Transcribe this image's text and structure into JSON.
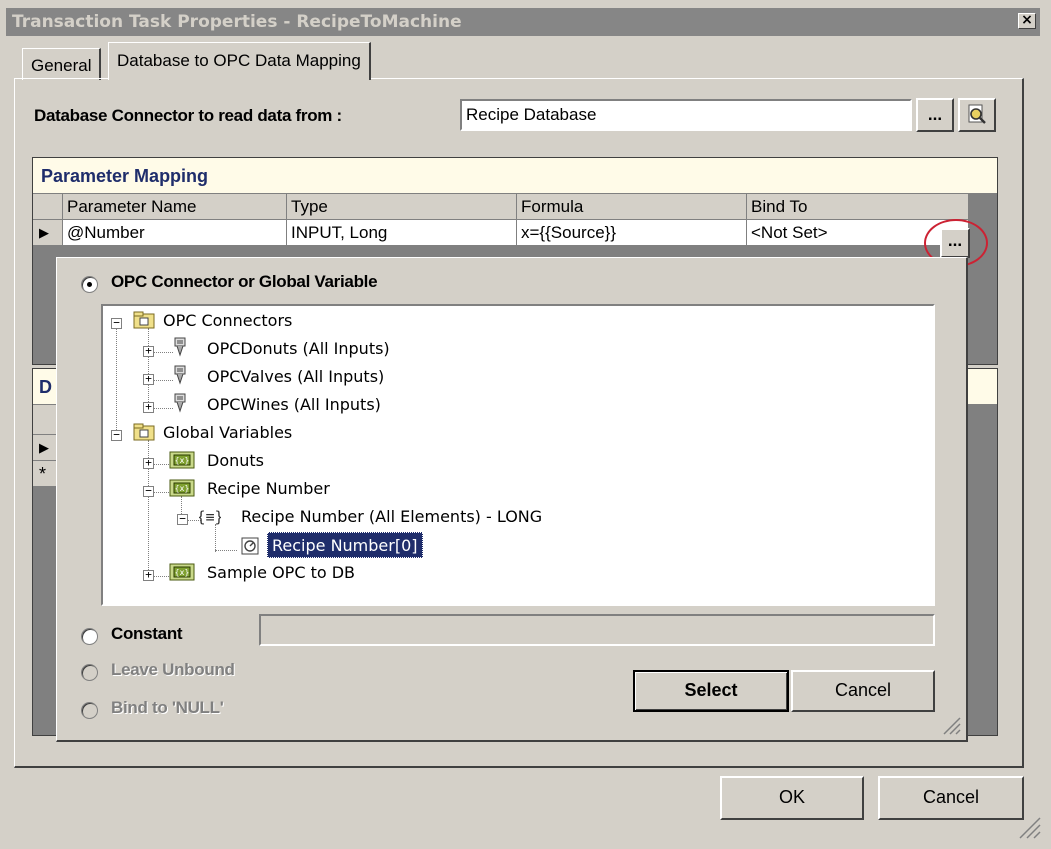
{
  "window": {
    "title": "Transaction Task Properties - RecipeToMachine",
    "close_glyph": "×"
  },
  "tabs": [
    {
      "label": "General"
    },
    {
      "label": "Database to OPC Data Mapping"
    }
  ],
  "db_connector": {
    "label": "Database Connector to read data from :",
    "value": "Recipe Database",
    "browse_label": "..."
  },
  "param_mapping": {
    "title": "Parameter Mapping",
    "columns": [
      "Parameter Name",
      "Type",
      "Formula",
      "Bind To"
    ],
    "row": {
      "name": "@Number",
      "type": "INPUT, Long",
      "formula": "x={{Source}}",
      "bind_to": "<Not Set>",
      "ellipsis": "..."
    }
  },
  "second_section": {
    "title_letter": "D",
    "new_row_marker": "*"
  },
  "popup": {
    "options": {
      "opc": "OPC Connector or Global Variable",
      "constant": "Constant",
      "leave_unbound": "Leave Unbound",
      "bind_null": "Bind to 'NULL'"
    },
    "selected_option": "opc",
    "constant_value": "",
    "tree": {
      "opc_connectors": "OPC Connectors",
      "opc_donuts": "OPCDonuts (All Inputs)",
      "opc_valves": "OPCValves (All Inputs)",
      "opc_wines": "OPCWines (All Inputs)",
      "global_variables": "Global Variables",
      "gv_donuts": "Donuts",
      "gv_recipe_number": "Recipe Number",
      "recipe_number_all": "Recipe Number (All Elements) - LONG",
      "recipe_number_0": "Recipe Number[0]",
      "sample_opc_to_db": "Sample OPC to DB"
    },
    "select_label": "Select",
    "cancel_label": "Cancel"
  },
  "footer": {
    "ok_label": "OK",
    "cancel_label": "Cancel"
  },
  "colors": {
    "face": "#d4d0c8",
    "title_bar": "#868686",
    "section_header": "#fffbe8",
    "section_title": "#1f2d6b",
    "selection": "#1f2d6b",
    "highlight_circle": "#cc2233"
  }
}
